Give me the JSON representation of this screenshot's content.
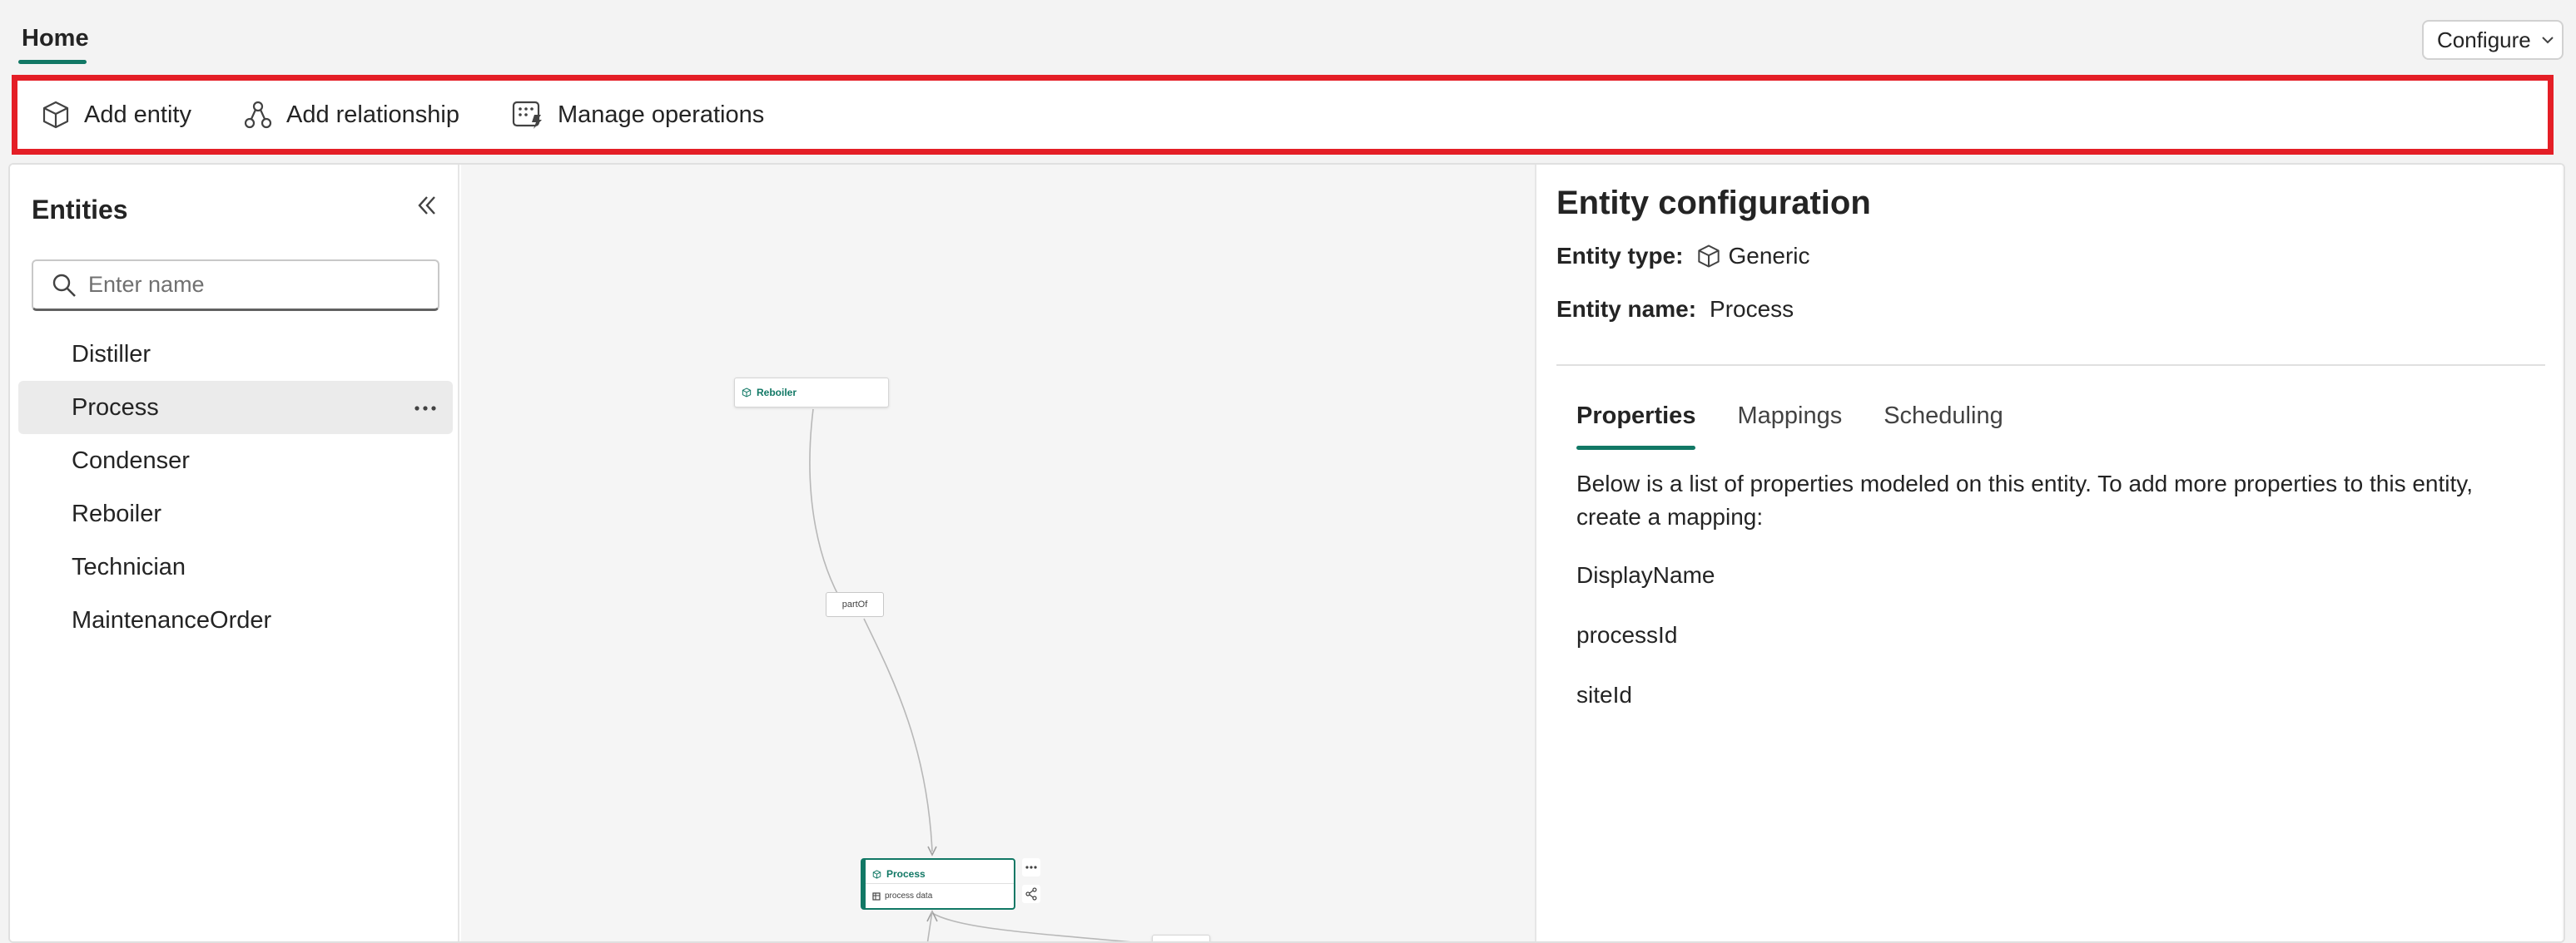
{
  "topbar": {
    "home_tab": "Home",
    "configure_label": "Configure"
  },
  "ribbon": {
    "add_entity": "Add entity",
    "add_relationship": "Add relationship",
    "manage_operations": "Manage operations"
  },
  "entities_pane": {
    "title": "Entities",
    "search_placeholder": "Enter name",
    "items": [
      "Distiller",
      "Process",
      "Condenser",
      "Reboiler",
      "Technician",
      "MaintenanceOrder"
    ],
    "selected": "Process"
  },
  "canvas": {
    "reboiler_node": "Reboiler",
    "edge_label": "partOf",
    "process_node_title": "Process",
    "process_node_sub": "process data"
  },
  "config": {
    "title": "Entity configuration",
    "entity_type_label": "Entity type:",
    "entity_type_value": "Generic",
    "entity_name_label": "Entity name:",
    "entity_name_value": "Process",
    "tabs": [
      "Properties",
      "Mappings",
      "Scheduling"
    ],
    "active_tab": "Properties",
    "description": "Below is a list of properties modeled on this entity. To add more properties to this entity, create a mapping:",
    "properties": [
      "DisplayName",
      "processId",
      "siteId"
    ]
  },
  "colors": {
    "accent": "#117865",
    "highlight_border": "#e41e26"
  }
}
